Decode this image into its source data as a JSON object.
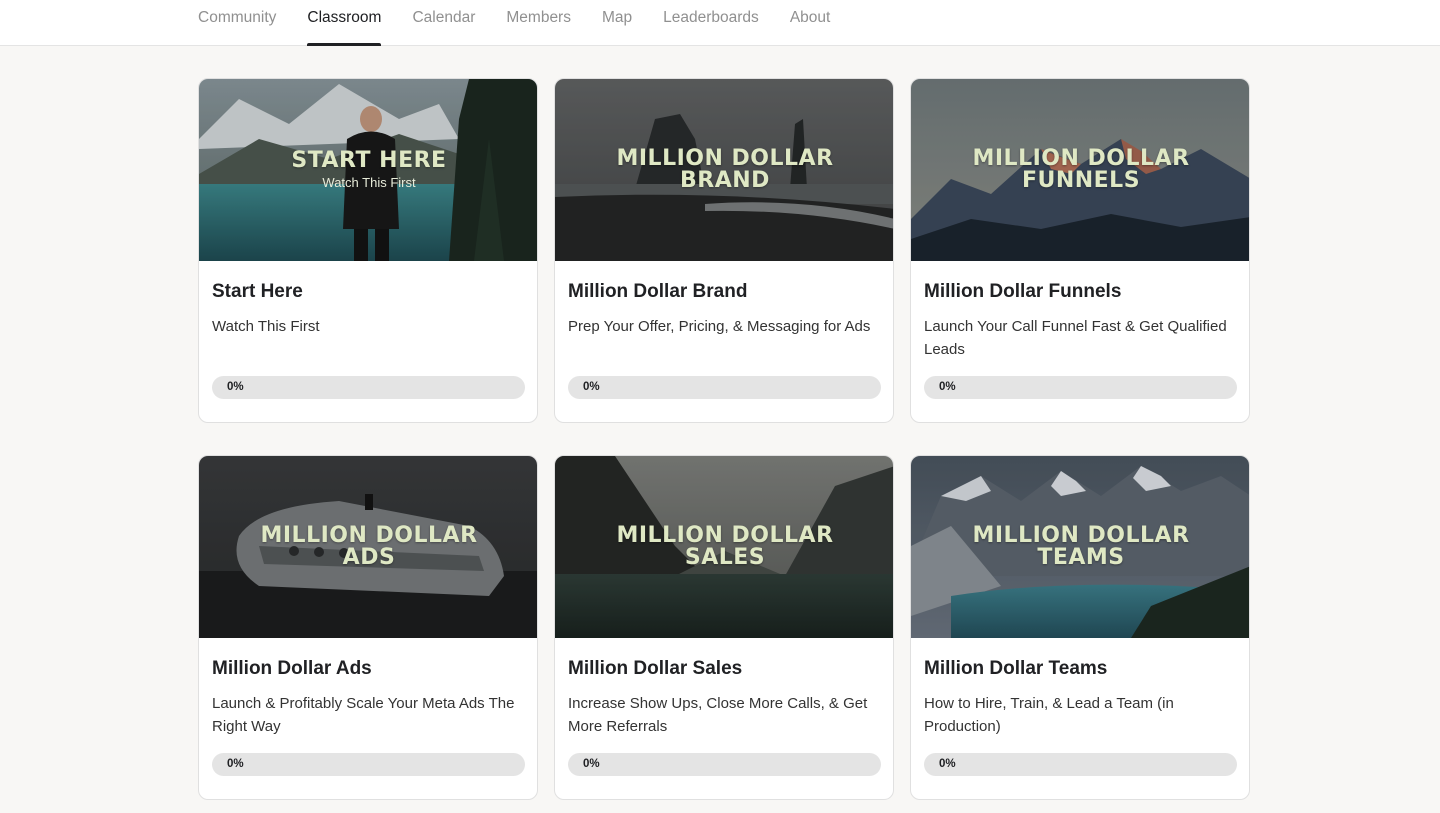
{
  "nav": {
    "tabs": [
      {
        "label": "Community",
        "active": false
      },
      {
        "label": "Classroom",
        "active": true
      },
      {
        "label": "Calendar",
        "active": false
      },
      {
        "label": "Members",
        "active": false
      },
      {
        "label": "Map",
        "active": false
      },
      {
        "label": "Leaderboards",
        "active": false
      },
      {
        "label": "About",
        "active": false
      }
    ]
  },
  "courses": [
    {
      "banner_title": "START HERE",
      "banner_sub": "Watch This First",
      "title": "Start Here",
      "description": "Watch This First",
      "progress_label": "0%",
      "progress": 0
    },
    {
      "banner_title": "MILLION DOLLAR BRAND",
      "title": "Million Dollar Brand",
      "description": "Prep Your Offer, Pricing, & Messaging for Ads",
      "progress_label": "0%",
      "progress": 0
    },
    {
      "banner_title": "MILLION DOLLAR FUNNELS",
      "title": "Million Dollar Funnels",
      "description": "Launch Your Call Funnel Fast & Get Qualified Leads",
      "progress_label": "0%",
      "progress": 0
    },
    {
      "banner_title": "MILLION DOLLAR ADS",
      "title": "Million Dollar Ads",
      "description": "Launch & Profitably Scale Your Meta Ads The Right Way",
      "progress_label": "0%",
      "progress": 0
    },
    {
      "banner_title": "MILLION DOLLAR SALES",
      "title": "Million Dollar Sales",
      "description": "Increase Show Ups, Close More Calls, & Get More Referrals",
      "progress_label": "0%",
      "progress": 0
    },
    {
      "banner_title": "MILLION DOLLAR TEAMS",
      "title": "Million Dollar Teams",
      "description": "How to Hire, Train, & Lead a Team (in Production)",
      "progress_label": "0%",
      "progress": 0
    }
  ],
  "colors": {
    "page_background": "#f8f7f5",
    "active_tab_underline": "#202124",
    "banner_text": "#dfe8c4",
    "progress_track": "#e4e4e4"
  }
}
